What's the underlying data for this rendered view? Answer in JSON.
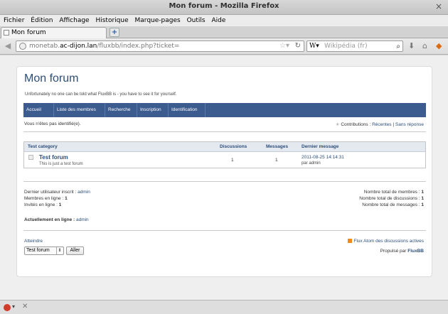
{
  "window": {
    "title": "Mon forum - Mozilla Firefox"
  },
  "menu": [
    "Fichier",
    "Édition",
    "Affichage",
    "Historique",
    "Marque-pages",
    "Outils",
    "Aide"
  ],
  "tab": {
    "title": "Mon forum"
  },
  "url": {
    "prefix": "monetab.",
    "domain": "ac-dijon.lan",
    "path": "/fluxbb/index.php?ticket="
  },
  "search": {
    "engine_label": "W",
    "placeholder": "Wikipédia (fr)"
  },
  "forum": {
    "title": "Mon forum",
    "description": "Unfortunately no one can be told what FluxBB is - you have to see it for yourself.",
    "nav": [
      "Accueil",
      "Liste des membres",
      "Recherche",
      "Inscription",
      "Identification"
    ],
    "status": "Vous n'êtes pas identifié(e).",
    "contrib_label": "Contributions :",
    "contrib_recent": "Récentes",
    "contrib_sep": "|",
    "contrib_unanswered": "Sans réponse"
  },
  "category": {
    "name": "Test category",
    "col_discussions": "Discussions",
    "col_messages": "Messages",
    "col_last": "Dernier message",
    "rows": [
      {
        "name": "Test forum",
        "desc": "This is just a test forum",
        "discussions": "1",
        "messages": "1",
        "last_date": "2011-08-25 14:14:31",
        "last_by": "par admin"
      }
    ]
  },
  "stats": {
    "last_user_label": "Dernier utilisateur inscrit :",
    "last_user": "admin",
    "members_online_label": "Membres en ligne :",
    "members_online": "1",
    "guests_online_label": "Invités en ligne :",
    "guests_online": "1",
    "total_members_label": "Nombre total de membres :",
    "total_members": "1",
    "total_topics_label": "Nombre total de discussions :",
    "total_topics": "1",
    "total_posts_label": "Nombre total de messages :",
    "total_posts": "1",
    "online_now_label": "Actuellement en ligne :",
    "online_now": "admin"
  },
  "footer": {
    "jump_label": "Atteindre",
    "jump_value": "Test forum",
    "go_label": "Aller",
    "rss_label": "Flux Atom des discussions actives",
    "powered_label": "Propulsé par",
    "powered_by": "FluxBB"
  },
  "colors": {
    "nav_bg": "#3c5b8e",
    "link": "#2b4e7a"
  }
}
